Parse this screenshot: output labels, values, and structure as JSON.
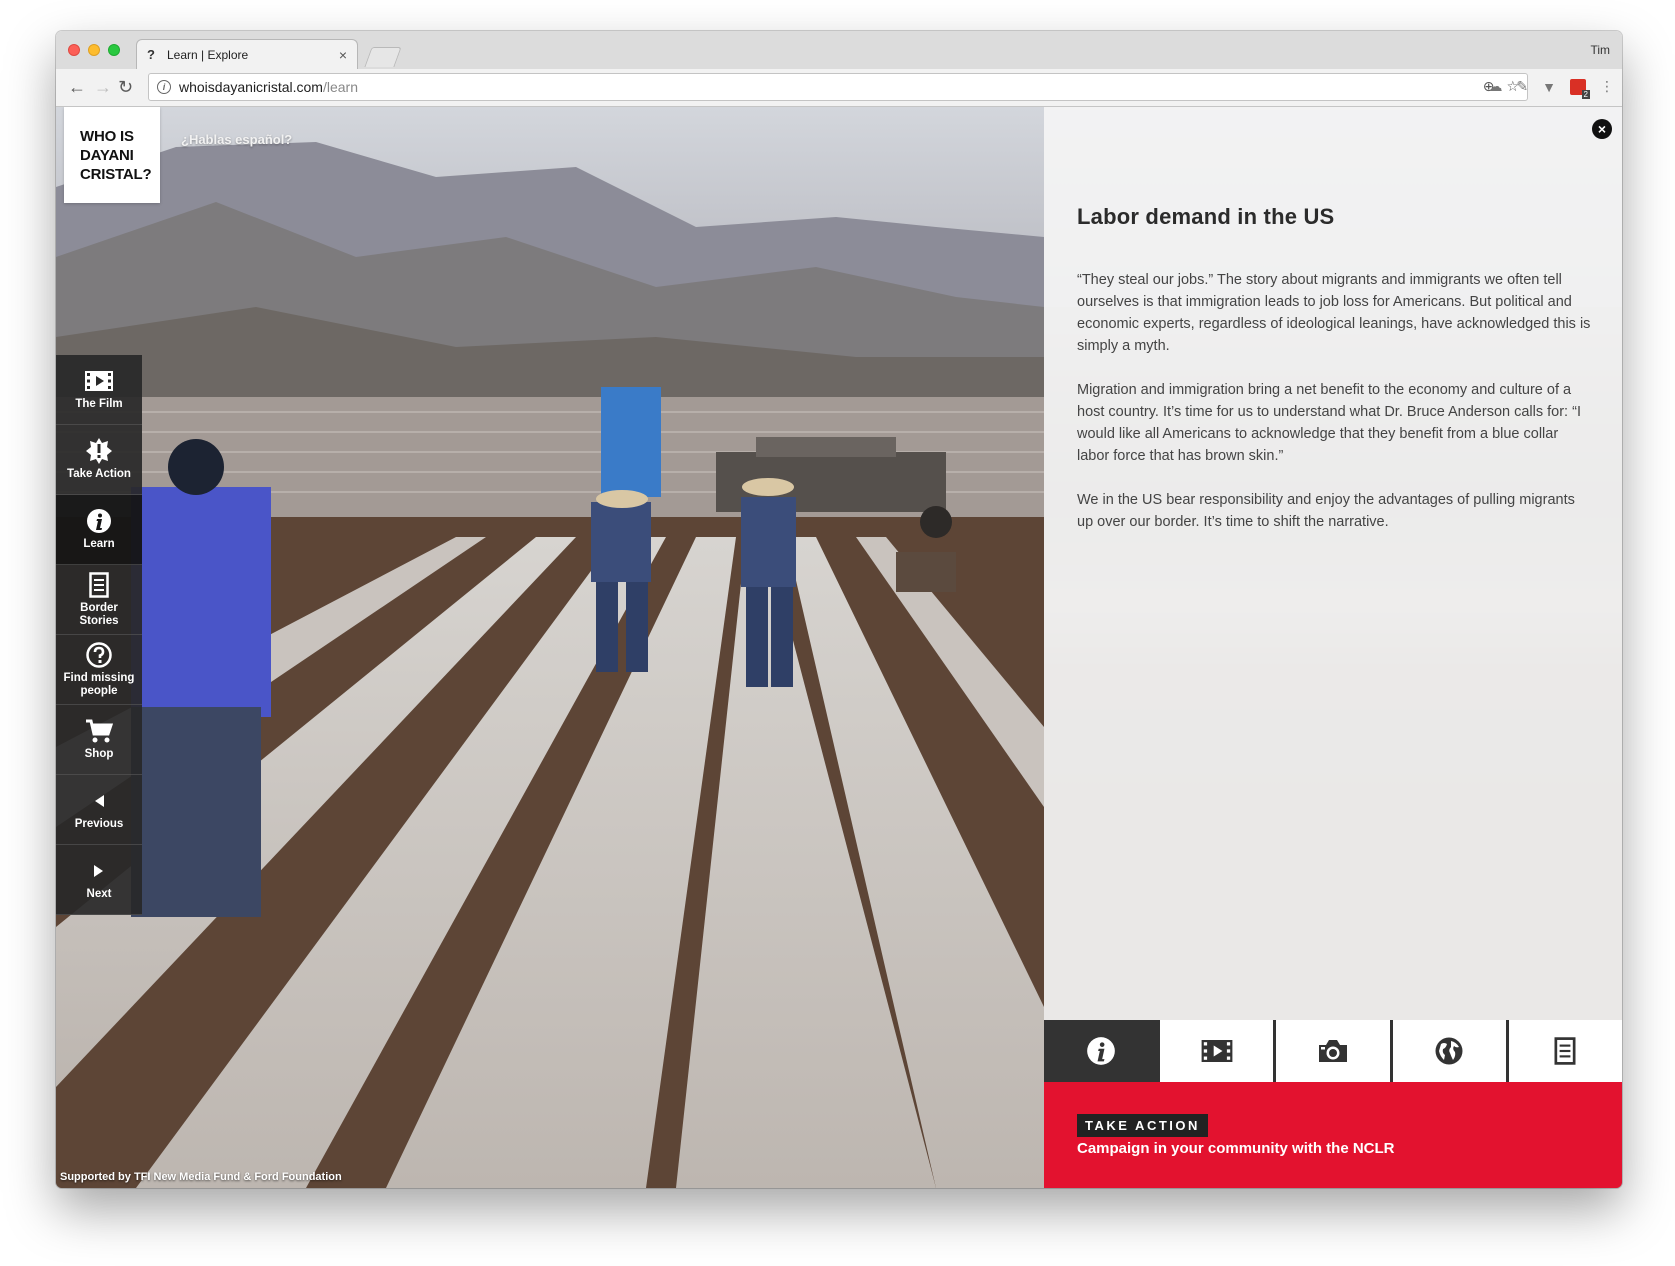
{
  "browser": {
    "tab_title": "Learn | Explore",
    "tab_favicon": "?",
    "tab_close": "×",
    "user": "Tim",
    "url_host": "whoisdayanicristal.com",
    "url_path": "/learn"
  },
  "site": {
    "logo_lines": [
      "WHO IS",
      "DAYANI",
      "CRISTAL?"
    ],
    "language_link": "¿Hablas español?",
    "footer_credit": "Supported by TFI New Media Fund & Ford Foundation"
  },
  "sidenav": [
    {
      "label": "The Film",
      "icon": "film-icon"
    },
    {
      "label": "Take Action",
      "icon": "action-burst-icon"
    },
    {
      "label": "Learn",
      "icon": "info-icon",
      "active": true
    },
    {
      "label": "Border Stories",
      "icon": "document-icon"
    },
    {
      "label": "Find missing people",
      "icon": "question-icon"
    },
    {
      "label": "Shop",
      "icon": "cart-icon"
    },
    {
      "label": "Previous",
      "icon": "left-arrow-icon"
    },
    {
      "label": "Next",
      "icon": "right-arrow-icon"
    }
  ],
  "panel": {
    "title": "Labor demand in the US",
    "paragraphs": [
      "“They steal our jobs.” The story about migrants and immigrants we often tell ourselves is that immigration leads to job loss for Americans. But political and economic experts, regardless of ideological leanings, have acknowledged this is simply a myth.",
      "Migration and immigration bring a net benefit to the economy and culture of a host country. It’s time for us to understand what Dr. Bruce Anderson calls for: “I would like all Americans to acknowledge that they benefit from a blue collar labor force that has brown skin.”",
      "We in the US bear responsibility and enjoy the advantages of pulling migrants up over our border. It’s time to shift the narrative."
    ],
    "icon_tabs": [
      "info-icon",
      "film-icon",
      "camera-icon",
      "globe-icon",
      "document-icon"
    ],
    "active_tab": 0
  },
  "cta": {
    "label": "TAKE ACTION",
    "text": "Campaign in your community with the NCLR",
    "color": "#e3122f"
  }
}
